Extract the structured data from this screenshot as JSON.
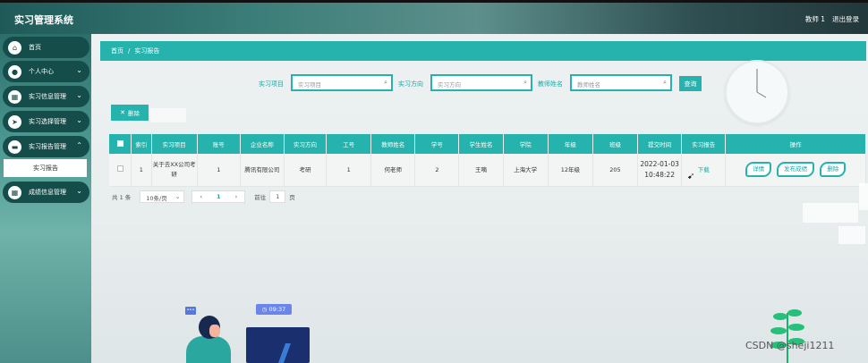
{
  "app": {
    "title": "实习管理系统",
    "user": "教师 1",
    "logout": "退出登录"
  },
  "sidebar": {
    "items": [
      {
        "label": "首页",
        "icon": "home-icon",
        "glyph": "⌂",
        "chevron": false
      },
      {
        "label": "个人中心",
        "icon": "user-icon",
        "glyph": "●",
        "chevron": true
      },
      {
        "label": "实习信息管理",
        "icon": "grid-icon",
        "glyph": "▦",
        "chevron": true
      },
      {
        "label": "实习选择管理",
        "icon": "send-icon",
        "glyph": "➤",
        "chevron": true
      },
      {
        "label": "实习报告管理",
        "icon": "ticket-icon",
        "glyph": "▬",
        "chevron": true
      },
      {
        "label": "成绩信息管理",
        "icon": "grid-icon",
        "glyph": "▦",
        "chevron": true
      }
    ],
    "sub_item": "实习报告"
  },
  "breadcrumb": {
    "home": "首页",
    "sep": "/",
    "current": "实习报告"
  },
  "search": {
    "f1_label": "实习项目",
    "f1_placeholder": "实习项目",
    "f2_label": "实习方向",
    "f2_placeholder": "实习方向",
    "f3_label": "教师姓名",
    "f3_placeholder": "教师姓名",
    "query_label": "查询"
  },
  "toolbar": {
    "delete_label": "删除"
  },
  "table": {
    "headers": [
      "索引",
      "实习项目",
      "账号",
      "企业名称",
      "实习方向",
      "工号",
      "教师姓名",
      "学号",
      "学生姓名",
      "学院",
      "年级",
      "班级",
      "提交时间",
      "实习报告",
      "操作"
    ],
    "rows": [
      {
        "index": "1",
        "project": "关于去XX公司考研",
        "account": "1",
        "company": "腾讯有限公司",
        "direction": "考研",
        "job_no": "1",
        "teacher": "何老师",
        "student_no": "2",
        "student_name": "王嘀",
        "college": "上海大学",
        "grade": "12年级",
        "class": "205",
        "submit_time": "2022-01-03 10:48:22",
        "report": "下载",
        "actions": {
          "detail": "详情",
          "publish": "发布成绩",
          "delete": "删除"
        }
      }
    ]
  },
  "pager": {
    "total": "共 1 条",
    "page_size": "10条/页",
    "prev": "‹",
    "current": "1",
    "next": "›",
    "goto_label": "前往",
    "goto_value": "1",
    "goto_suffix": "页"
  },
  "decor": {
    "time": "09:37",
    "watermark": "CSDN @sheji1211"
  },
  "colors": {
    "accent": "#26b3ad",
    "sidebar_item": "#154d4a"
  }
}
